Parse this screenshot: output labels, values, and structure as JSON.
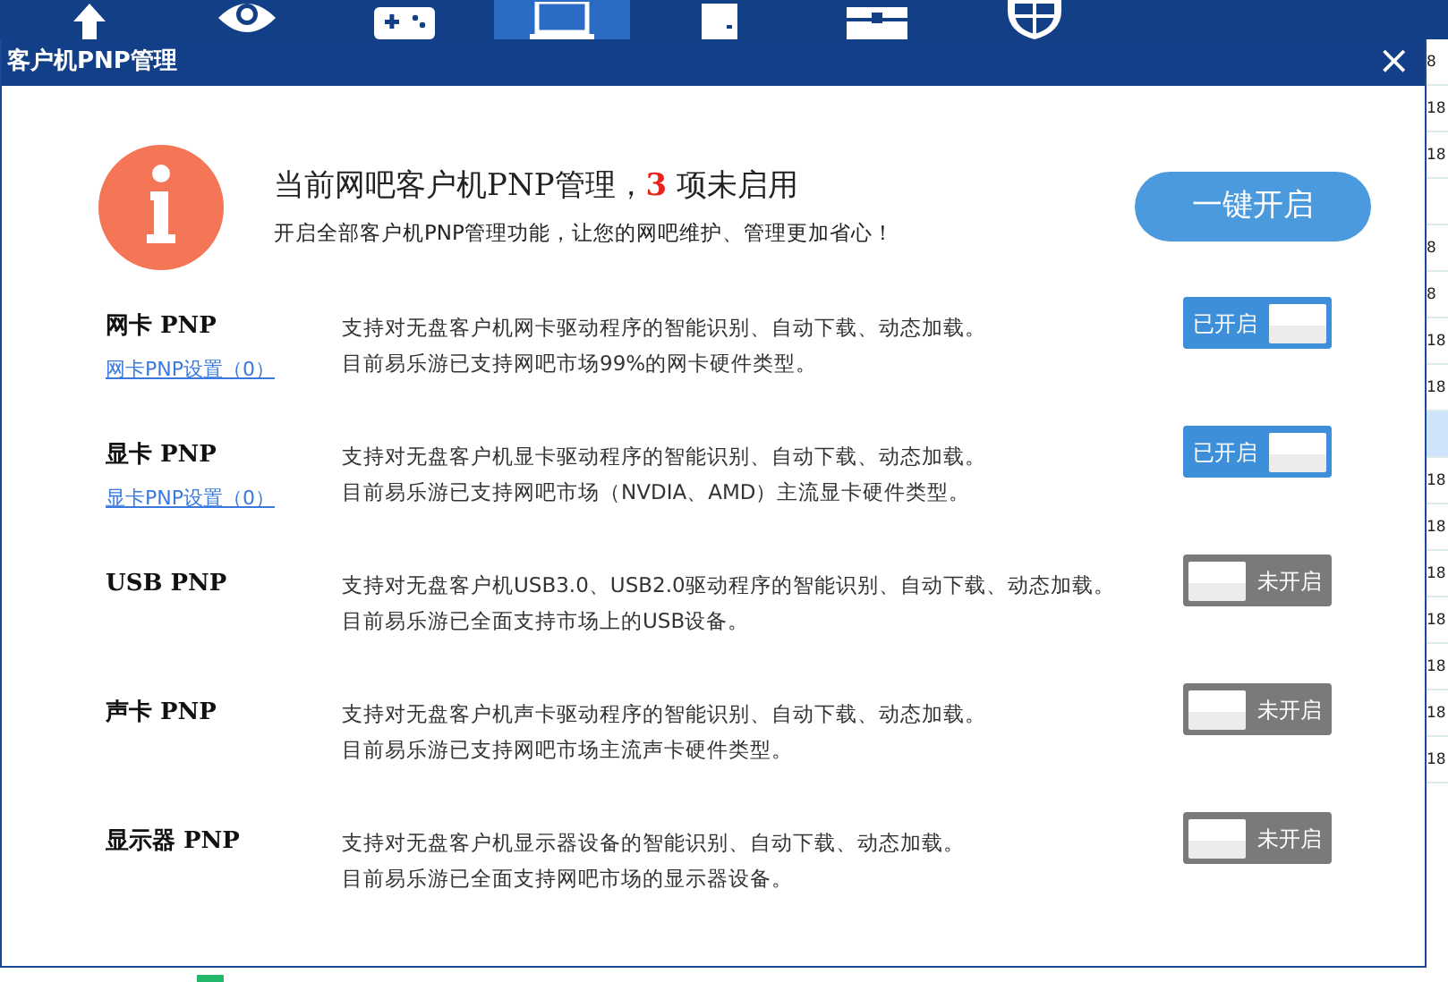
{
  "toolbar": {
    "items": [
      {
        "kind": "arrow",
        "selected": false
      },
      {
        "kind": "eye",
        "selected": false
      },
      {
        "kind": "gamepad",
        "selected": false
      },
      {
        "kind": "monitor",
        "selected": true
      },
      {
        "kind": "document",
        "selected": false
      },
      {
        "kind": "chest",
        "selected": false
      },
      {
        "kind": "shield",
        "selected": false
      }
    ]
  },
  "dialog": {
    "title": "客户机PNP管理",
    "close": "×",
    "header": {
      "title_before": "当前网吧客户机PNP管理，",
      "count": "3",
      "title_after": " 项未启用",
      "subtitle": "开启全部客户机PNP管理功能，让您的网吧维护、管理更加省心！",
      "button": "一键开启"
    },
    "rows": [
      {
        "name": "网卡 PNP",
        "link": "网卡PNP设置（0）",
        "lines": [
          "支持对无盘客户机网卡驱动程序的智能识别、自动下载、动态加载。",
          "目前易乐游已支持网吧市场99%的网卡硬件类型。"
        ],
        "on": true,
        "toggle_label": "已开启"
      },
      {
        "name": "显卡 PNP",
        "link": "显卡PNP设置（0）",
        "lines": [
          "支持对无盘客户机显卡驱动程序的智能识别、自动下载、动态加载。",
          "目前易乐游已支持网吧市场（NVDIA、AMD）主流显卡硬件类型。"
        ],
        "on": true,
        "toggle_label": "已开启"
      },
      {
        "name": "USB PNP",
        "lines": [
          "支持对无盘客户机USB3.0、USB2.0驱动程序的智能识别、自动下载、动态加载。",
          "目前易乐游已全面支持市场上的USB设备。"
        ],
        "on": false,
        "toggle_label": "未开启"
      },
      {
        "name": "声卡 PNP",
        "lines": [
          "支持对无盘客户机声卡驱动程序的智能识别、自动下载、动态加载。",
          "目前易乐游已支持网吧市场主流声卡硬件类型。"
        ],
        "on": false,
        "toggle_label": "未开启"
      },
      {
        "name": "显示器 PNP",
        "lines": [
          "支持对无盘客户机显示器设备的智能识别、自动下载、动态加载。",
          "目前易乐游已全面支持网吧市场的显示器设备。"
        ],
        "on": false,
        "toggle_label": "未开启"
      }
    ]
  },
  "background_table": {
    "side_cells": [
      {
        "text": "8",
        "selected": false
      },
      {
        "text": "18",
        "selected": false
      },
      {
        "text": "18",
        "selected": false
      },
      {
        "selected": false
      },
      {
        "text": "8",
        "selected": false
      },
      {
        "text": "8",
        "selected": false
      },
      {
        "text": "18",
        "selected": false
      },
      {
        "text": "18",
        "selected": false
      },
      {
        "selected": true
      },
      {
        "text": "18",
        "selected": false
      },
      {
        "text": "18",
        "selected": false
      },
      {
        "text": "18",
        "selected": false
      },
      {
        "text": "18",
        "selected": false
      },
      {
        "text": "18",
        "selected": false
      },
      {
        "text": "18",
        "selected": false
      },
      {
        "text": "18",
        "selected": false
      }
    ]
  }
}
